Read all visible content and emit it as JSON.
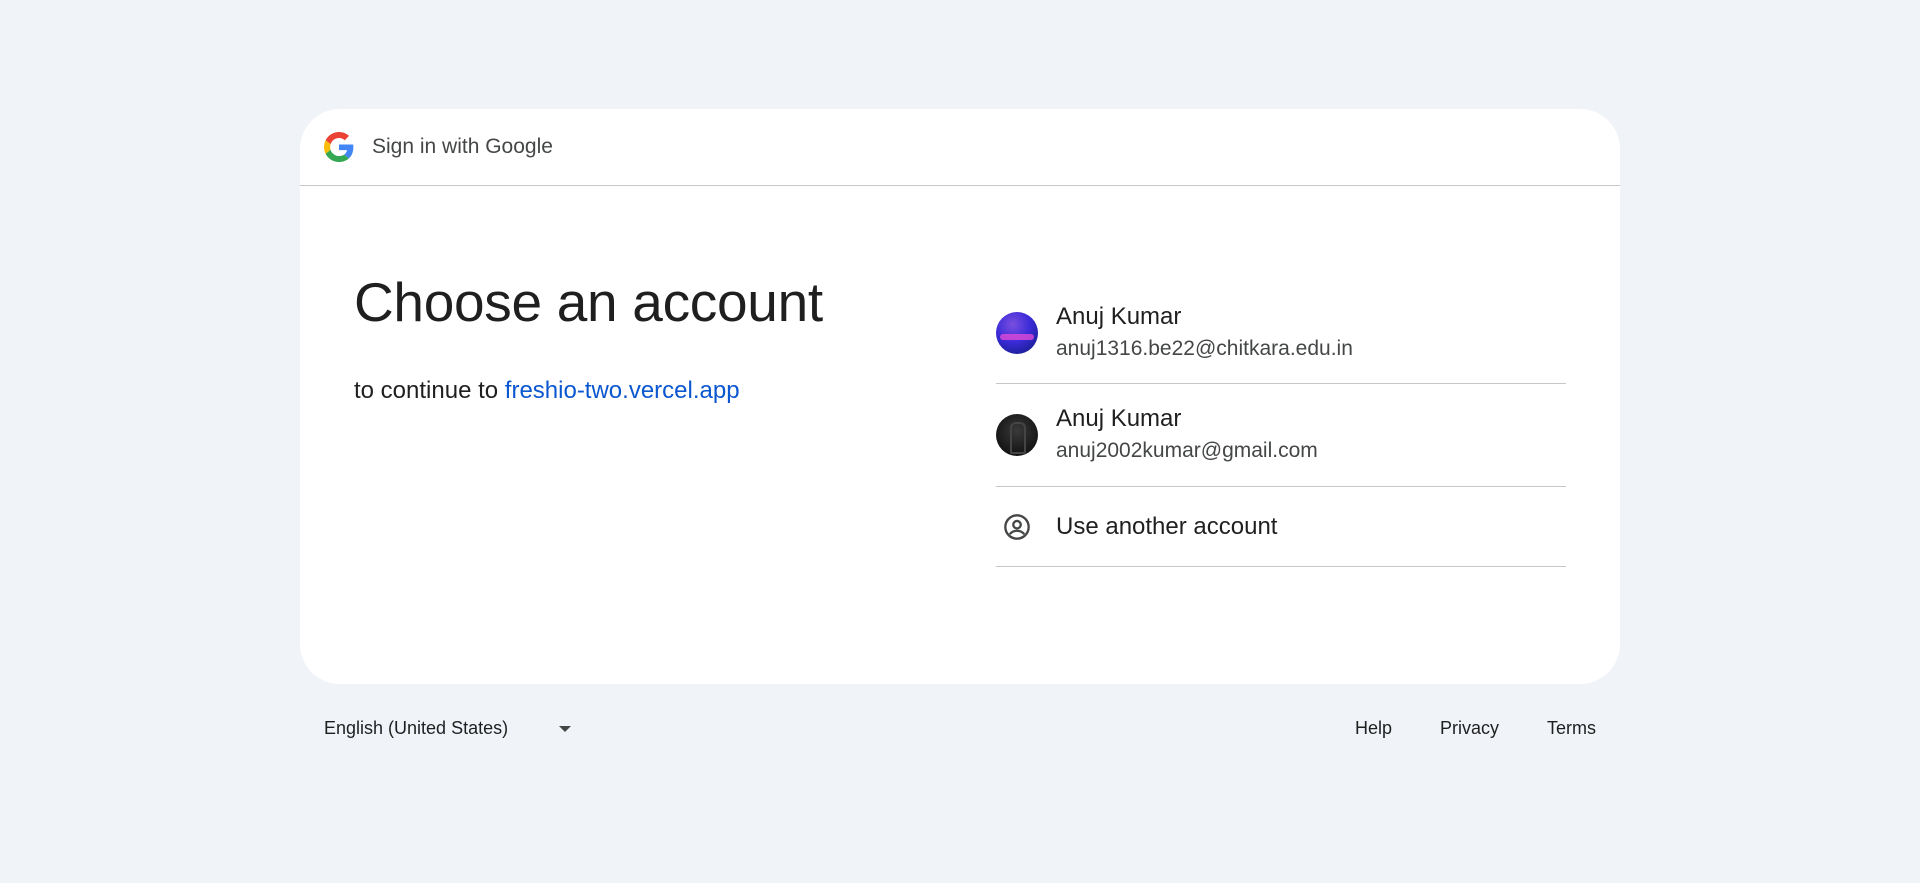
{
  "header": {
    "title": "Sign in with Google",
    "logo_icon": "google-g-icon"
  },
  "main": {
    "headline": "Choose an account",
    "continue_prefix": "to continue to",
    "app_link": "freshio-two.vercel.app"
  },
  "accounts": [
    {
      "name": "Anuj Kumar",
      "email": "anuj1316.be22@chitkara.edu.in",
      "avatar": "avatar-image"
    },
    {
      "name": "Anuj Kumar",
      "email": "anuj2002kumar@gmail.com",
      "avatar": "avatar-image"
    }
  ],
  "use_another": {
    "label": "Use another account",
    "icon": "account-circle-icon"
  },
  "footer": {
    "language": "English (United States)",
    "links": [
      "Help",
      "Privacy",
      "Terms"
    ]
  },
  "colors": {
    "background": "#f0f4f9",
    "card": "#ffffff",
    "link": "#0b57d0",
    "divider": "#c7c7c7"
  }
}
